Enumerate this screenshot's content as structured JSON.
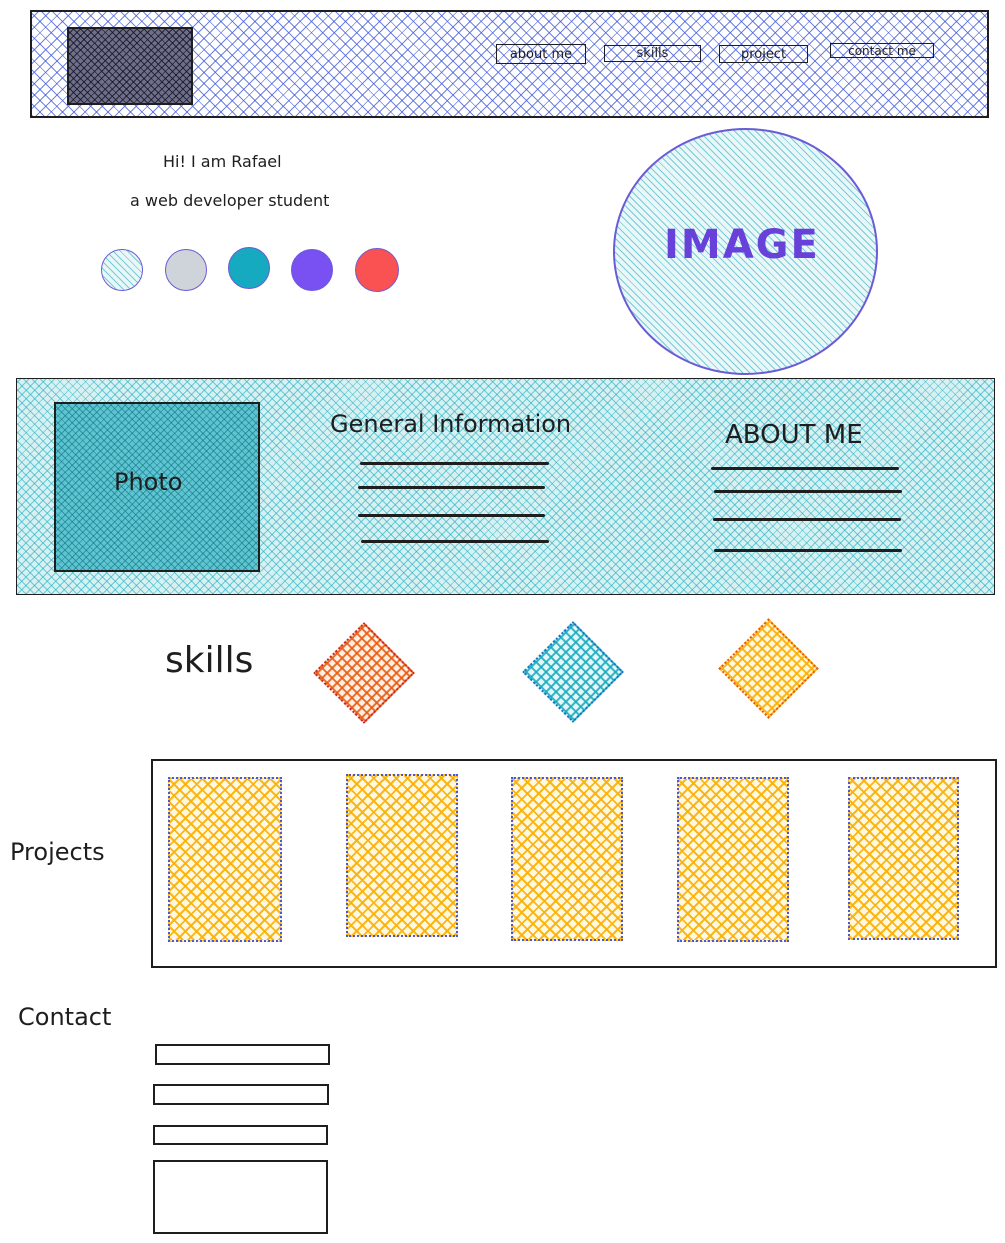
{
  "header": {
    "nav": [
      {
        "label": "about me"
      },
      {
        "label": "skills"
      },
      {
        "label": "project"
      },
      {
        "label": "contact me"
      }
    ]
  },
  "hero": {
    "greeting": "Hi! I am Rafael",
    "subtitle": "a web developer student",
    "image_label": "IMAGE",
    "color_dots": [
      "#a5d8dc",
      "#ced4da",
      "#15aabf",
      "#7950f2",
      "#fa5252"
    ]
  },
  "info": {
    "photo_label": "Photo",
    "general_title": "General Information",
    "about_title": "ABOUT ME"
  },
  "skills": {
    "title": "skills",
    "colors": [
      "#e8590c",
      "#15aabf",
      "#fab005"
    ]
  },
  "projects": {
    "title": "Projects",
    "card_count_colors": [
      "#fab005",
      "#fab005",
      "#fab005",
      "#fab005",
      "#fab005"
    ]
  },
  "contact": {
    "title": "Contact"
  }
}
